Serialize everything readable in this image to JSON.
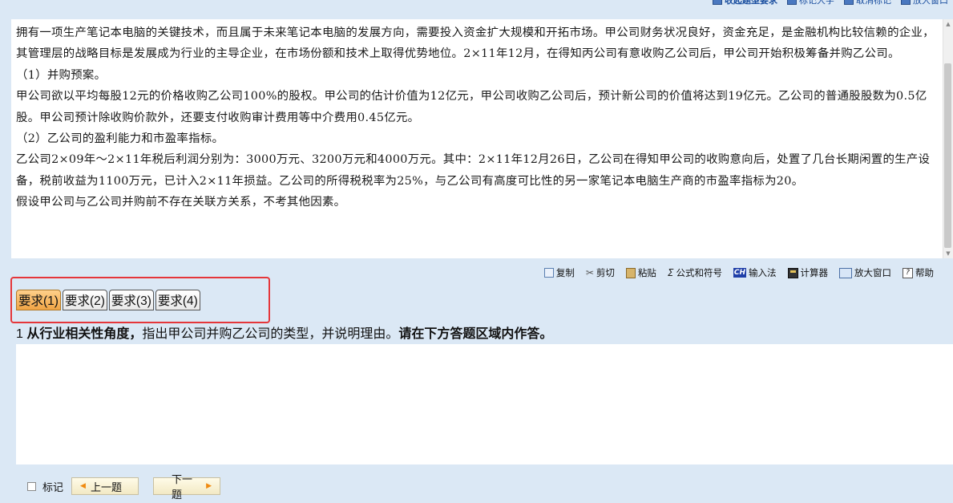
{
  "top_toolbar": {
    "items": [
      "收起题型要求",
      "标记大字",
      "取消标记",
      "放大窗口"
    ]
  },
  "stem": {
    "paragraphs": [
      "拥有一项生产笔记本电脑的关键技术，而且属于未来笔记本电脑的发展方向，需要投入资金扩大规模和开拓市场。甲公司财务状况良好，资金充足，是金融机构比较信赖的企业，其管理层的战略目标是发展成为行业的主导企业，在市场份额和技术上取得优势地位。2×11年12月，在得知丙公司有意收购乙公司后，甲公司开始积极筹备并购乙公司。",
      "（1）并购预案。",
      "甲公司欲以平均每股12元的价格收购乙公司100%的股权。甲公司的估计价值为12亿元，甲公司收购乙公司后，预计新公司的价值将达到19亿元。乙公司的普通股股数为0.5亿股。甲公司预计除收购价款外，还要支付收购审计费用等中介费用0.45亿元。",
      "（2）乙公司的盈利能力和市盈率指标。",
      "乙公司2×09年～2×11年税后利润分别为：3000万元、3200万元和4000万元。其中：2×11年12月26日，乙公司在得知甲公司的收购意向后，处置了几台长期闲置的生产设备，税前收益为1100万元，已计入2×11年损益。乙公司的所得税税率为25%，与乙公司有高度可比性的另一家笔记本电脑生产商的市盈率指标为20。",
      "假设甲公司与乙公司并购前不存在关联方关系，不考其他因素。"
    ]
  },
  "tools": {
    "copy": "复制",
    "cut": "剪切",
    "paste": "粘贴",
    "formula": "公式和符号",
    "ime_badge": "CH",
    "ime": "输入法",
    "calculator": "计算器",
    "zoom": "放大窗口",
    "help": "帮助"
  },
  "tabs": [
    {
      "label": "要求(1)",
      "active": true
    },
    {
      "label": "要求(2)",
      "active": false
    },
    {
      "label": "要求(3)",
      "active": false
    },
    {
      "label": "要求(4)",
      "active": false
    }
  ],
  "question": {
    "number": "1",
    "bold_lead": "从行业相关性角度，",
    "text": "指出甲公司并购乙公司的类型，并说明理由。",
    "bold_tail": "请在下方答题区域内作答。"
  },
  "answer": {
    "value": ""
  },
  "bottom_nav": {
    "mark_label": "标记",
    "prev_label": "上一题",
    "next_label": "下一题"
  },
  "colors": {
    "background": "#dbe8f5",
    "highlight_border": "#e5363a",
    "active_tab": "#f5b65a"
  }
}
